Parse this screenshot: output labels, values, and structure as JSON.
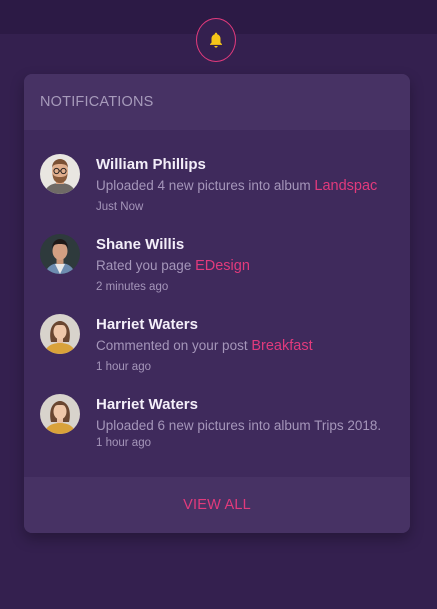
{
  "colors": {
    "background": "#34204f",
    "panel": "#3f2a5c",
    "accent": "#e23a7c",
    "bell": "#f5c518"
  },
  "bell": {
    "icon": "bell-icon"
  },
  "panel": {
    "title": "NOTIFICATIONS",
    "items": [
      {
        "avatar": "avatar-man-beard-glasses",
        "name": "William Phillips",
        "message": "Uploaded 4 new pictures into album",
        "highlight": "Landspac",
        "time": "Just Now"
      },
      {
        "avatar": "avatar-man-dark-hair",
        "name": "Shane Willis",
        "message": "Rated you page",
        "highlight": "EDesign",
        "time": "2 minutes ago"
      },
      {
        "avatar": "avatar-woman-yellow-top",
        "name": "Harriet Waters",
        "message": "Commented on your post",
        "highlight": "Breakfast",
        "time": "1 hour ago"
      },
      {
        "avatar": "avatar-woman-yellow-top",
        "name": "Harriet Waters",
        "message": "Uploaded 6 new pictures into album Trips 2018.",
        "highlight": "",
        "time": "1 hour ago"
      }
    ],
    "view_all": "VIEW ALL"
  }
}
